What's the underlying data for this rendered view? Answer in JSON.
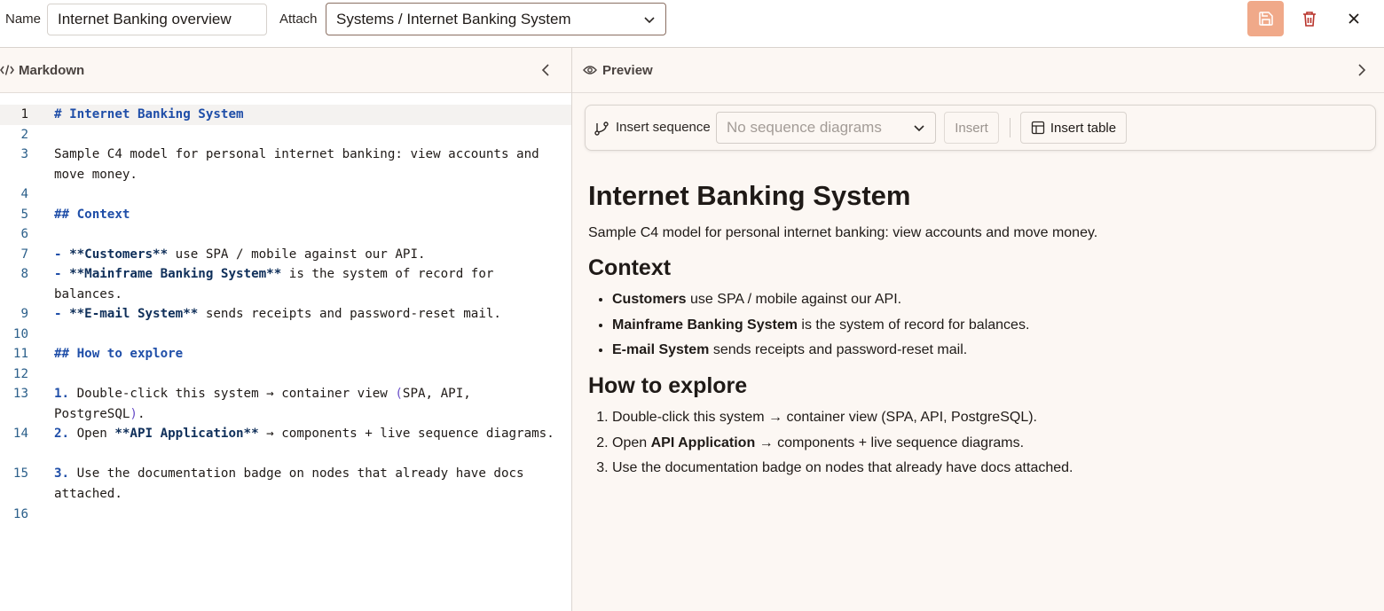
{
  "topbar": {
    "name_label": "Name",
    "name_value": "Internet Banking overview",
    "attach_label": "Attach",
    "attach_value": "Systems / Internet Banking System"
  },
  "panes": {
    "markdown_title": "Markdown",
    "preview_title": "Preview"
  },
  "editor": {
    "lines": [
      {
        "n": "1",
        "text": "# Internet Banking System"
      },
      {
        "n": "2",
        "text": ""
      },
      {
        "n": "3",
        "text": "Sample C4 model for personal internet banking: view accounts and move money."
      },
      {
        "n": "4",
        "text": ""
      },
      {
        "n": "5",
        "text": "## Context"
      },
      {
        "n": "6",
        "text": ""
      },
      {
        "n": "7",
        "text": "- **Customers** use SPA / mobile against our API."
      },
      {
        "n": "8",
        "text": "- **Mainframe Banking System** is the system of record for balances."
      },
      {
        "n": "9",
        "text": "- **E-mail System** sends receipts and password-reset mail."
      },
      {
        "n": "10",
        "text": ""
      },
      {
        "n": "11",
        "text": "## How to explore"
      },
      {
        "n": "12",
        "text": ""
      },
      {
        "n": "13",
        "text": "1. Double-click this system → container view (SPA, API, PostgreSQL)."
      },
      {
        "n": "14",
        "text": "2. Open **API Application** → components + live sequence diagrams."
      },
      {
        "n": "15",
        "text": "3. Use the documentation badge on nodes that already have docs attached."
      },
      {
        "n": "16",
        "text": ""
      }
    ]
  },
  "preview_toolbar": {
    "insert_sequence_label": "Insert sequence",
    "sequence_placeholder": "No sequence diagrams",
    "insert_button": "Insert",
    "insert_table_button": "Insert table"
  },
  "preview_doc": {
    "h1": "Internet Banking System",
    "intro": "Sample C4 model for personal internet banking: view accounts and move money.",
    "h2_context": "Context",
    "context_items": [
      {
        "bold": "Customers",
        "rest": " use SPA / mobile against our API."
      },
      {
        "bold": "Mainframe Banking System",
        "rest": " is the system of record for balances."
      },
      {
        "bold": "E-mail System",
        "rest": " sends receipts and password-reset mail."
      }
    ],
    "h2_explore": "How to explore",
    "explore_items": [
      {
        "pre": "Double-click this system → container view (SPA, API, PostgreSQL).",
        "bold": "",
        "rest": ""
      },
      {
        "pre": "Open ",
        "bold": "API Application",
        "rest": " → components + live sequence diagrams."
      },
      {
        "pre": "Use the documentation badge on nodes that already have docs attached.",
        "bold": "",
        "rest": ""
      }
    ]
  },
  "icons": {
    "save": "save-icon",
    "delete": "trash-icon",
    "close": "close-icon",
    "code": "code-icon",
    "eye": "eye-icon",
    "branch": "branch-icon",
    "table": "table-icon"
  },
  "colors": {
    "save_button": "#f0a989",
    "delete_icon": "#b8322a",
    "pane_background": "#fcf7f3",
    "markdown_heading": "#1f4ea8"
  }
}
